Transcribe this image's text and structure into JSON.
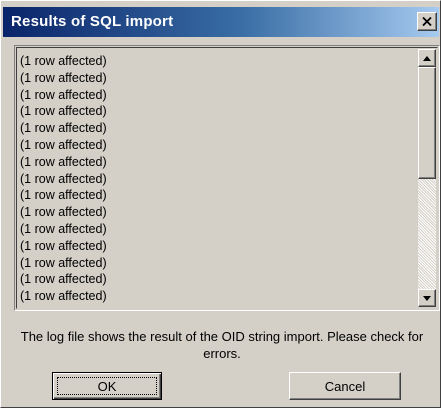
{
  "window": {
    "title": "Results of SQL import",
    "close_glyph": "✕"
  },
  "log": {
    "lines": [
      "(1 row affected)",
      "(1 row affected)",
      "(1 row affected)",
      "(1 row affected)",
      "(1 row affected)",
      "(1 row affected)",
      "(1 row affected)",
      "(1 row affected)",
      "(1 row affected)",
      "(1 row affected)",
      "(1 row affected)",
      "(1 row affected)",
      "(1 row affected)",
      "(1 row affected)",
      "(1 row affected)"
    ],
    "scroll_up_icon": "scroll-up-arrow-icon",
    "scroll_down_icon": "scroll-down-arrow-icon"
  },
  "message": "The log file shows the result of the OID string import. Please check for errors.",
  "buttons": {
    "ok_label": "OK",
    "cancel_label": "Cancel"
  },
  "colors": {
    "title_start": "#0a246a",
    "title_end": "#a6caf0",
    "face": "#d4d0c8"
  }
}
